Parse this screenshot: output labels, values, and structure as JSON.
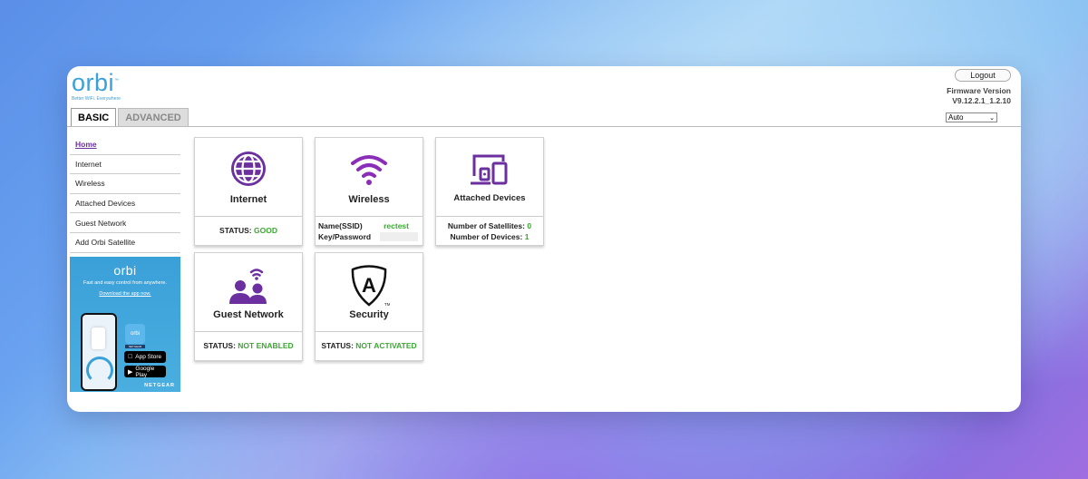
{
  "brand": {
    "logo": "orbi",
    "tm": "™",
    "tagline": "Better WiFi. Everywhere"
  },
  "tabs": [
    {
      "label": "BASIC",
      "active": true
    },
    {
      "label": "ADVANCED",
      "active": false
    }
  ],
  "header": {
    "logout_label": "Logout",
    "firmware_label": "Firmware Version",
    "firmware_value": "V9.12.2.1_1.2.10",
    "language_selected": "Auto"
  },
  "sidebar": {
    "items": [
      {
        "label": "Home",
        "active": true
      },
      {
        "label": "Internet",
        "active": false
      },
      {
        "label": "Wireless",
        "active": false
      },
      {
        "label": "Attached Devices",
        "active": false
      },
      {
        "label": "Guest Network",
        "active": false
      },
      {
        "label": "Add Orbi Satellite",
        "active": false
      }
    ]
  },
  "promo": {
    "logo": "orbi",
    "text": "Fast and easy control from anywhere.",
    "link": "Download the app now.",
    "app_icon_label": "orbi",
    "app_sub_label": "NETGEAR",
    "app_store": "App Store",
    "google_play": "Google Play",
    "brand": "NETGEAR"
  },
  "cards": {
    "internet": {
      "title": "Internet",
      "status_label": "STATUS:",
      "status_value": "GOOD",
      "icon": "globe-icon"
    },
    "wireless": {
      "title": "Wireless",
      "ssid_label": "Name(SSID)",
      "ssid_value": "rectest",
      "key_label": "Key/Password",
      "icon": "wifi-icon"
    },
    "attached": {
      "title": "Attached Devices",
      "satellites_label": "Number of Satellites:",
      "satellites_value": "0",
      "devices_label": "Number of Devices:",
      "devices_value": "1",
      "icon": "devices-icon"
    },
    "guest": {
      "title": "Guest Network",
      "status_label": "STATUS:",
      "status_value": "NOT ENABLED",
      "icon": "guest-network-icon"
    },
    "security": {
      "title": "Security",
      "status_label": "STATUS:",
      "status_value": "NOT ACTIVATED",
      "icon": "armor-shield-icon",
      "icon_letter": "A",
      "icon_tm": "TM"
    }
  },
  "colors": {
    "accent_purple": "#6b2fa0",
    "status_green": "#3aa832",
    "brand_blue": "#3aa0d8"
  }
}
